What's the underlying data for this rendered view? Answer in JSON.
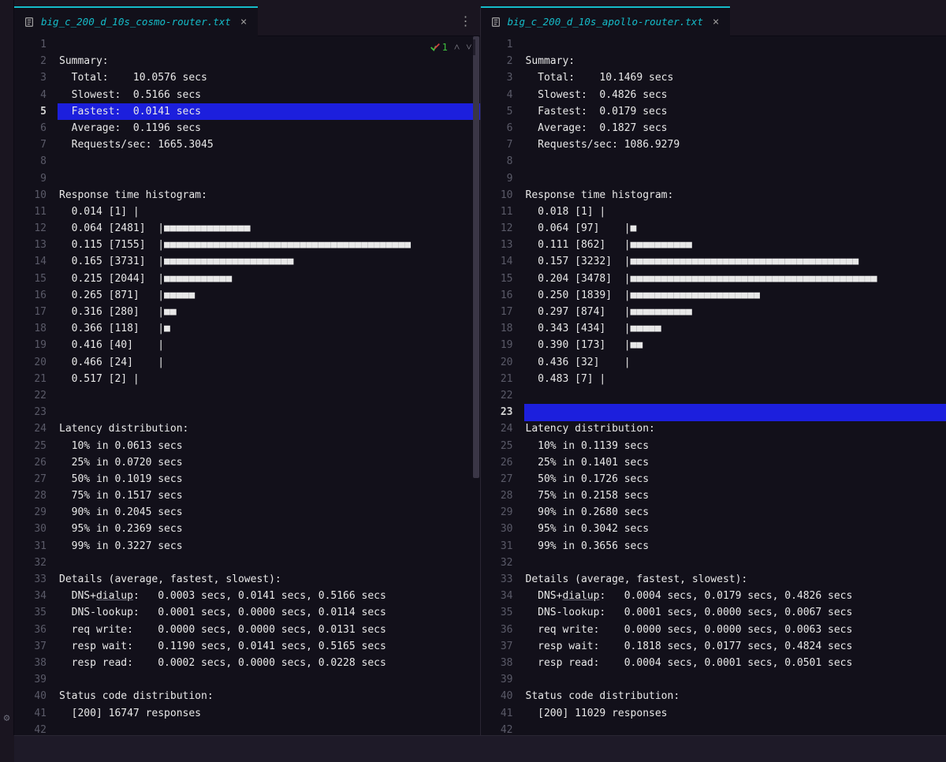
{
  "left": {
    "filename": "big_c_200_d_10s_cosmo-router.txt",
    "highlight_line": 5,
    "overlay": {
      "check_count": "1"
    },
    "lines": [
      "",
      "Summary:",
      "  Total:    10.0576 secs",
      "  Slowest:  0.5166 secs",
      "  Fastest:  0.0141 secs",
      "  Average:  0.1196 secs",
      "  Requests/sec: 1665.3045",
      "",
      "",
      "Response time histogram:",
      "  0.014 [1] |",
      "  0.064 [2481]  |■■■■■■■■■■■■■■",
      "  0.115 [7155]  |■■■■■■■■■■■■■■■■■■■■■■■■■■■■■■■■■■■■■■■■",
      "  0.165 [3731]  |■■■■■■■■■■■■■■■■■■■■■",
      "  0.215 [2044]  |■■■■■■■■■■■",
      "  0.265 [871]   |■■■■■",
      "  0.316 [280]   |■■",
      "  0.366 [118]   |■",
      "  0.416 [40]    |",
      "  0.466 [24]    |",
      "  0.517 [2] |",
      "",
      "",
      "Latency distribution:",
      "  10% in 0.0613 secs",
      "  25% in 0.0720 secs",
      "  50% in 0.1019 secs",
      "  75% in 0.1517 secs",
      "  90% in 0.2045 secs",
      "  95% in 0.2369 secs",
      "  99% in 0.3227 secs",
      "",
      "Details (average, fastest, slowest):",
      "  DNS+dialup:   0.0003 secs, 0.0141 secs, 0.5166 secs",
      "  DNS-lookup:   0.0001 secs, 0.0000 secs, 0.0114 secs",
      "  req write:    0.0000 secs, 0.0000 secs, 0.0131 secs",
      "  resp wait:    0.1190 secs, 0.0141 secs, 0.5165 secs",
      "  resp read:    0.0002 secs, 0.0000 secs, 0.0228 secs",
      "",
      "Status code distribution:",
      "  [200] 16747 responses",
      ""
    ]
  },
  "right": {
    "filename": "big_c_200_d_10s_apollo-router.txt",
    "highlight_line": 23,
    "lines": [
      "",
      "Summary:",
      "  Total:    10.1469 secs",
      "  Slowest:  0.4826 secs",
      "  Fastest:  0.0179 secs",
      "  Average:  0.1827 secs",
      "  Requests/sec: 1086.9279",
      "",
      "",
      "Response time histogram:",
      "  0.018 [1] |",
      "  0.064 [97]    |■",
      "  0.111 [862]   |■■■■■■■■■■",
      "  0.157 [3232]  |■■■■■■■■■■■■■■■■■■■■■■■■■■■■■■■■■■■■■",
      "  0.204 [3478]  |■■■■■■■■■■■■■■■■■■■■■■■■■■■■■■■■■■■■■■■■",
      "  0.250 [1839]  |■■■■■■■■■■■■■■■■■■■■■",
      "  0.297 [874]   |■■■■■■■■■■",
      "  0.343 [434]   |■■■■■",
      "  0.390 [173]   |■■",
      "  0.436 [32]    |",
      "  0.483 [7] |",
      "",
      "",
      "Latency distribution:",
      "  10% in 0.1139 secs",
      "  25% in 0.1401 secs",
      "  50% in 0.1726 secs",
      "  75% in 0.2158 secs",
      "  90% in 0.2680 secs",
      "  95% in 0.3042 secs",
      "  99% in 0.3656 secs",
      "",
      "Details (average, fastest, slowest):",
      "  DNS+dialup:   0.0004 secs, 0.0179 secs, 0.4826 secs",
      "  DNS-lookup:   0.0001 secs, 0.0000 secs, 0.0067 secs",
      "  req write:    0.0000 secs, 0.0000 secs, 0.0063 secs",
      "  resp wait:    0.1818 secs, 0.0177 secs, 0.4824 secs",
      "  resp read:    0.0004 secs, 0.0001 secs, 0.0501 secs",
      "",
      "Status code distribution:",
      "  [200] 11029 responses",
      ""
    ]
  }
}
